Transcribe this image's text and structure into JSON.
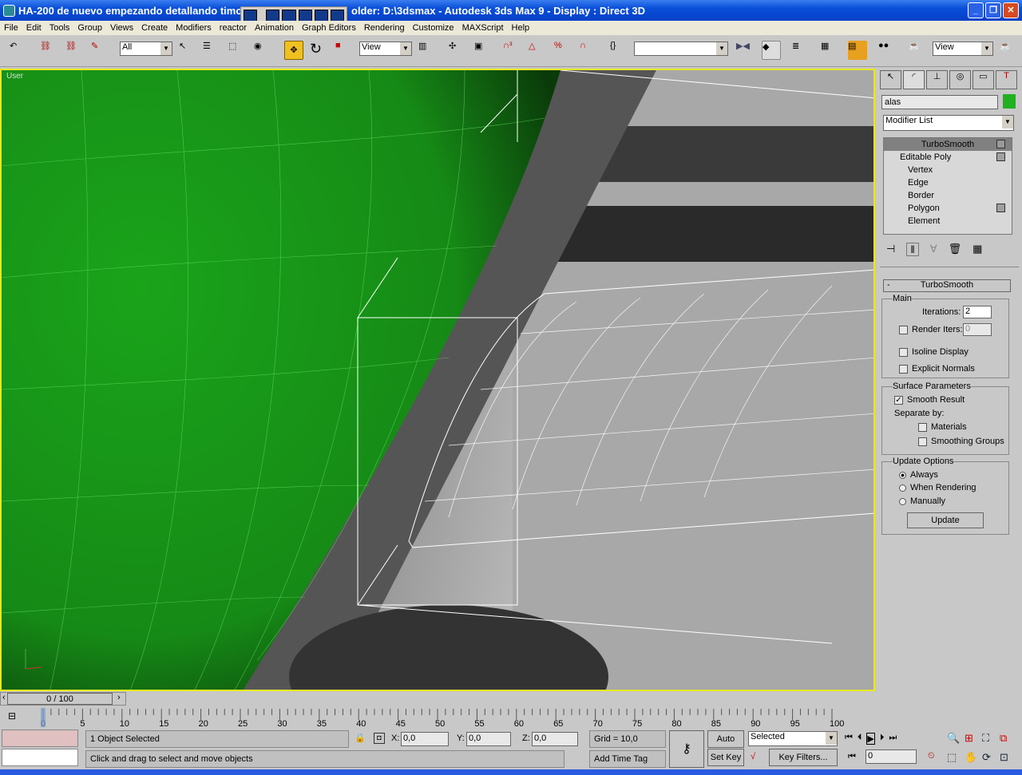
{
  "title": "HA-200 de nuevo empezando detallando timo... - Project Folder: D:\\3dsmax - Autodesk 3ds Max 9 - Display : Direct 3D",
  "title_visible": "HA-200 de nuevo empezando detallando timo",
  "title_right": "older: D:\\3dsmax      - Autodesk 3ds Max 9    - Display : Direct 3D",
  "menu": [
    "File",
    "Edit",
    "Tools",
    "Group",
    "Views",
    "Create",
    "Modifiers",
    "reactor",
    "Animation",
    "Graph Editors",
    "Rendering",
    "Customize",
    "MAXScript",
    "Help"
  ],
  "toolbar": {
    "selection_filter": "All",
    "ref_coord": "View",
    "named_sel": "",
    "view2": "View"
  },
  "viewport": {
    "label": "User",
    "sphere_color": "#1aa01a"
  },
  "panel": {
    "object_name": "alas",
    "object_color": "#20b020",
    "modifier_list": "Modifier List",
    "stack": [
      "TurboSmooth",
      "Editable Poly",
      "Vertex",
      "Edge",
      "Border",
      "Polygon",
      "Element"
    ],
    "rollout_title": "TurboSmooth",
    "main_label": "Main",
    "iterations_label": "Iterations:",
    "iterations": "2",
    "render_iters_label": "Render Iters:",
    "render_iters": "0",
    "isoline": "Isoline Display",
    "explicit_normals": "Explicit Normals",
    "surface_label": "Surface Parameters",
    "smooth_result": "Smooth Result",
    "separate_by": "Separate by:",
    "materials": "Materials",
    "smoothing_groups": "Smoothing Groups",
    "update_label": "Update Options",
    "always": "Always",
    "when_rendering": "When Rendering",
    "manually": "Manually",
    "update_button": "Update"
  },
  "timeline": {
    "slider": "0 / 100",
    "ticks": [
      "0",
      "5",
      "10",
      "15",
      "20",
      "25",
      "30",
      "35",
      "40",
      "45",
      "50",
      "55",
      "60",
      "65",
      "70",
      "75",
      "80",
      "85",
      "90",
      "95",
      "100"
    ]
  },
  "status": {
    "selected": "1 Object Selected",
    "prompt": "Click and drag to select and move objects",
    "x": "0,0",
    "y": "0,0",
    "z": "0,0",
    "grid": "Grid = 10,0",
    "add_time_tag": "Add Time Tag",
    "auto_key": "Auto Key",
    "set_key": "Set Key",
    "key_mode": "Selected",
    "key_filters": "Key Filters...",
    "frame": "0"
  }
}
